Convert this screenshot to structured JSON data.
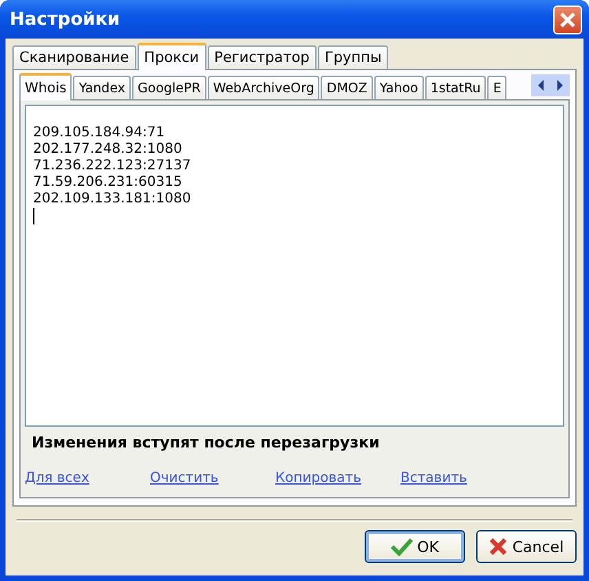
{
  "window": {
    "title": "Настройки"
  },
  "tabs": [
    {
      "label": "Сканирование",
      "selected": false
    },
    {
      "label": "Прокси",
      "selected": true
    },
    {
      "label": "Регистратор",
      "selected": false
    },
    {
      "label": "Группы",
      "selected": false
    }
  ],
  "subtabs": [
    {
      "label": "Whois",
      "selected": true
    },
    {
      "label": "Yandex",
      "selected": false
    },
    {
      "label": "GooglePR",
      "selected": false
    },
    {
      "label": "WebArchiveOrg",
      "selected": false
    },
    {
      "label": "DMOZ",
      "selected": false
    },
    {
      "label": "Yahoo",
      "selected": false
    },
    {
      "label": "1statRu",
      "selected": false
    },
    {
      "label": "E",
      "selected": false
    }
  ],
  "proxy_list": {
    "lines": [
      "209.105.184.94:71",
      "202.177.248.32:1080",
      "71.236.222.123:27137",
      "71.59.206.231:60315",
      "202.109.133.181:1080"
    ]
  },
  "notice": "Изменения вступят после перезагрузки",
  "links": [
    "Для всех",
    "Очистить",
    "Копировать",
    "Вставить"
  ],
  "buttons": [
    {
      "kind": "ok",
      "label": "OK"
    },
    {
      "kind": "cancel",
      "label": "Cancel"
    }
  ]
}
